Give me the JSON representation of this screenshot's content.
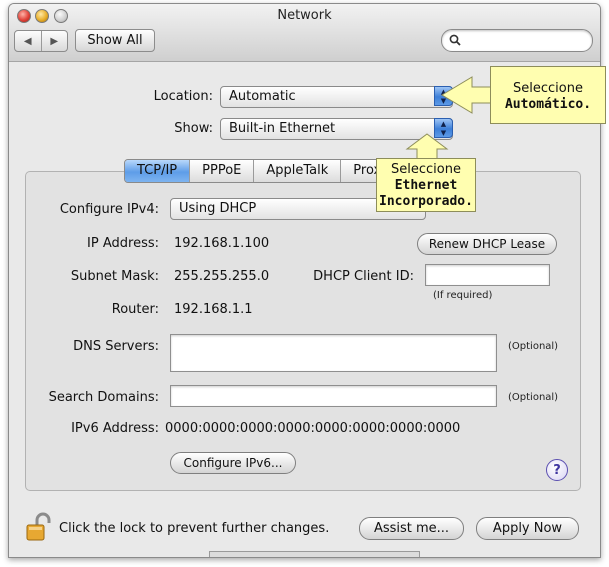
{
  "window": {
    "title": "Network"
  },
  "toolbar": {
    "back_glyph": "◀",
    "forward_glyph": "▶",
    "show_all_label": "Show All",
    "search_placeholder": "",
    "search_icon": "magnifier-icon"
  },
  "location": {
    "label": "Location:",
    "value": "Automatic"
  },
  "show": {
    "label": "Show:",
    "value": "Built-in Ethernet"
  },
  "tabs": [
    {
      "label": "TCP/IP",
      "active": true
    },
    {
      "label": "PPPoE",
      "active": false
    },
    {
      "label": "AppleTalk",
      "active": false
    },
    {
      "label": "Proxi",
      "active": false
    }
  ],
  "tcpip": {
    "configure_label": "Configure IPv4:",
    "configure_value": "Using DHCP",
    "ip_label": "IP Address:",
    "ip_value": "192.168.1.100",
    "renew_button": "Renew DHCP Lease",
    "subnet_label": "Subnet Mask:",
    "subnet_value": "255.255.255.0",
    "client_id_label": "DHCP Client ID:",
    "client_id_value": "",
    "client_id_hint": "(If required)",
    "router_label": "Router:",
    "router_value": "192.168.1.1",
    "dns_label": "DNS Servers:",
    "dns_value": "",
    "dns_hint": "(Optional)",
    "search_label": "Search Domains:",
    "search_value": "",
    "search_hint": "(Optional)",
    "ipv6_label": "IPv6 Address:",
    "ipv6_value": "0000:0000:0000:0000:0000:0000:0000:0000",
    "configure_ipv6_button": "Configure IPv6...",
    "help_glyph": "?"
  },
  "footer": {
    "lock_text": "Click the lock to prevent further changes.",
    "assist_button": "Assist me...",
    "apply_button": "Apply Now"
  },
  "callouts": {
    "location": {
      "line1": "Seleccione",
      "line2": "Automático."
    },
    "show": {
      "line1": "Seleccione",
      "line2": "Ethernet",
      "line3": "Incorporado."
    }
  },
  "colors": {
    "callout_bg": "#fffeb0",
    "accent_blue": "#5e9de8"
  }
}
